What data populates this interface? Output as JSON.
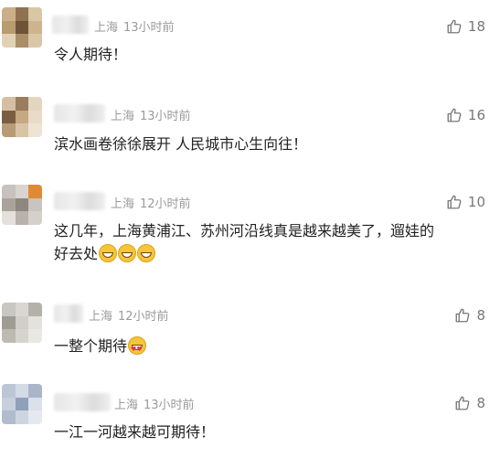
{
  "comments": [
    {
      "location": "上海",
      "time": "13小时前",
      "text": "令人期待！",
      "likes": "18",
      "emojis": [],
      "avatar_colors": [
        "#c9b08a",
        "#8f7252",
        "#d8c6a4",
        "#b89b6f",
        "#6d5439",
        "#cdb48e",
        "#e1d2b6",
        "#a98e68",
        "#d9c7a8"
      ]
    },
    {
      "location": "上海",
      "time": "13小时前",
      "text": "滨水画卷徐徐展开 人民城市心生向往！",
      "likes": "16",
      "emojis": [],
      "avatar_colors": [
        "#d5bfa0",
        "#9a7d5c",
        "#e3d6c0",
        "#7a5e42",
        "#c4a981",
        "#e8dcc8",
        "#b99c76",
        "#d7c4a6",
        "#eee4d4"
      ]
    },
    {
      "location": "上海",
      "time": "12小时前",
      "text": "这几年，上海黄浦江、苏州河沿线真是越来越美了，遛娃的好去处",
      "likes": "10",
      "emojis": [
        "grin",
        "grin",
        "grin"
      ],
      "avatar_colors": [
        "#c7c2bd",
        "#d9d4cf",
        "#e08a36",
        "#a9a39c",
        "#8d877f",
        "#c9c4be",
        "#e4e0db",
        "#b8b2ab",
        "#d5d0ca"
      ]
    },
    {
      "location": "上海",
      "time": "12小时前",
      "text": "一整个期待",
      "likes": "8",
      "emojis": [
        "heart-eyes"
      ],
      "avatar_colors": [
        "#c8c7c1",
        "#d9d7d2",
        "#b3b1a9",
        "#9f9c94",
        "#d0cec7",
        "#e4e2dc",
        "#bdbab2",
        "#d6d4ce",
        "#e9e8e3"
      ]
    },
    {
      "location": "上海",
      "time": "13小时前",
      "text": "一江一河越来越可期待！",
      "likes": "8",
      "emojis": [],
      "avatar_colors": [
        "#bcc6d6",
        "#d4dbe6",
        "#a9b5c9",
        "#c7cfdc",
        "#8fa0ba",
        "#dbe1ea",
        "#b0bbcd",
        "#cdd5e1",
        "#e5e9ef"
      ]
    }
  ]
}
